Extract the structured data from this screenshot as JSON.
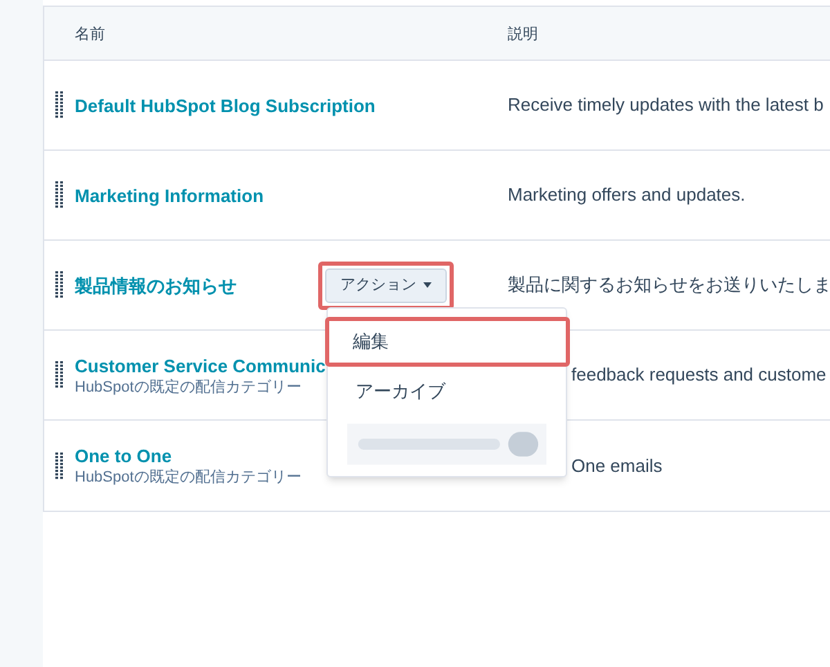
{
  "table": {
    "columns": [
      {
        "label": "名前"
      },
      {
        "label": "説明"
      }
    ],
    "rows": [
      {
        "name": "Default HubSpot Blog Subscription",
        "description": "Receive timely updates with the latest b"
      },
      {
        "name": "Marketing Information",
        "description": "Marketing offers and updates."
      },
      {
        "name": "製品情報のお知らせ",
        "actions_button": {
          "label": "アクション",
          "highlighted": true
        },
        "description": "製品に関するお知らせをお送りいたしま"
      },
      {
        "name": "Customer Service Communic",
        "subtitle": "HubSpotの既定の配信カテゴリー",
        "description": "feedback requests and custome",
        "partly_hidden": true
      },
      {
        "name": "One to One",
        "subtitle": "HubSpotの既定の配信カテゴリー",
        "description": "One emails",
        "partly_hidden": true
      }
    ]
  },
  "dropdown_menu": {
    "items": [
      {
        "kind": "item",
        "label": "編集",
        "highlighted": true
      },
      {
        "kind": "item",
        "label": "アーカイブ",
        "highlighted": false
      },
      {
        "kind": "blurred"
      }
    ]
  }
}
